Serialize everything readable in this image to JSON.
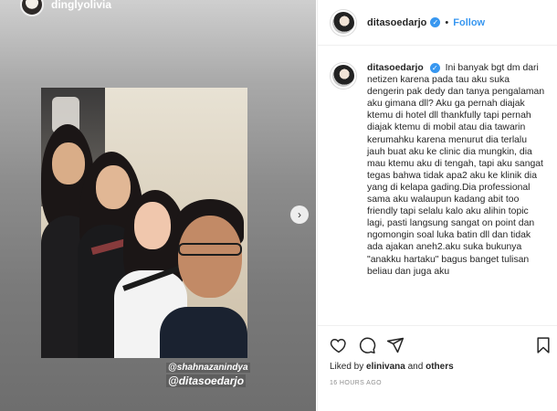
{
  "story": {
    "username": "dinglyolivia",
    "mentions": [
      "@shahnazanindya",
      "@ditasoedarjo"
    ],
    "next_glyph": "›"
  },
  "post": {
    "username": "ditasoedarjo",
    "follow_label": "Follow",
    "separator": "•",
    "caption": "Ini banyak bgt dm dari netizen karena pada tau aku suka dengerin pak dedy dan tanya pengalaman aku gimana dll? Aku ga pernah diajak ktemu di hotel dll thankfully tapi pernah diajak ktemu di mobil atau dia tawarin kerumahku karena menurut dia terlalu jauh buat aku ke clinic dia mungkin, dia mau ktemu aku di tengah, tapi aku sangat tegas bahwa tidak apa2 aku ke klinik dia yang di kelapa gading.Dia professional sama aku walaupun kadang abit too friendly tapi selalu kalo aku alihin topic lagi, pasti langsung sangat on point dan ngomongin soal luka batin dll dan tidak ada ajakan aneh2.aku suka bukunya \"anakku hartaku\" bagus banget tulisan beliau dan juga aku",
    "likes_prefix": "Liked by ",
    "liked_by": "elinivana",
    "likes_mid": " and ",
    "likes_others": "others",
    "timestamp": "16 HOURS AGO"
  },
  "colors": {
    "accent": "#3897f0",
    "text": "#262626",
    "muted": "#8e8e8e"
  },
  "icons": [
    "heart-icon",
    "comment-icon",
    "share-icon",
    "bookmark-icon",
    "verified-icon",
    "chevron-right-icon"
  ]
}
